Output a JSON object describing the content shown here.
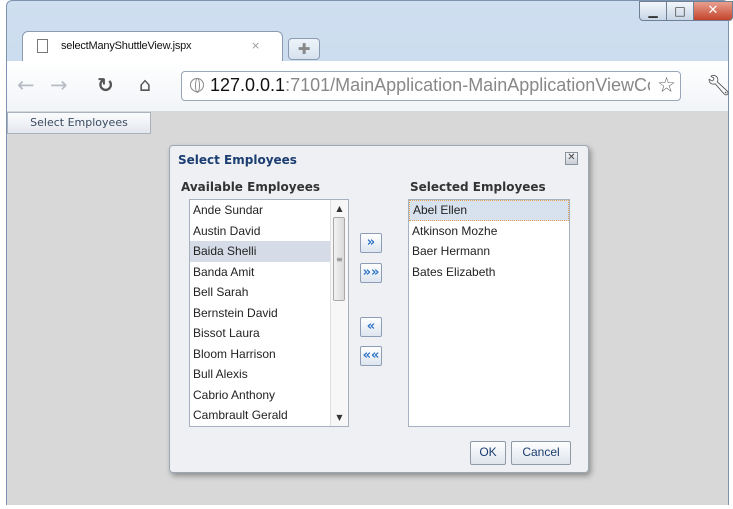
{
  "browser": {
    "tab_title": "selectManyShuttleView.jspx",
    "tab_close": "×",
    "new_tab": "✚",
    "url_host": "127.0.0.1",
    "url_rest": ":7101/MainApplication-MainApplicationViewCor",
    "window_controls": {
      "minimize": "▁",
      "maximize": "□",
      "close": "✕"
    }
  },
  "page": {
    "open_dialog_button": "Select Employees"
  },
  "dialog": {
    "title": "Select Employees",
    "close": "✕",
    "available_heading": "Available Employees",
    "selected_heading": "Selected Employees",
    "available": [
      "Ande Sundar",
      "Austin David",
      "Baida Shelli",
      "Banda Amit",
      "Bell Sarah",
      "Bernstein David",
      "Bissot Laura",
      "Bloom Harrison",
      "Bull Alexis",
      "Cabrio Anthony",
      "Cambrault Gerald"
    ],
    "available_selected_index": 2,
    "selected": [
      "Abel Ellen",
      "Atkinson Mozhe",
      "Baer Hermann",
      "Bates Elizabeth"
    ],
    "selected_focused_index": 0,
    "move_right": "»",
    "move_all_right": "»»",
    "move_left": "«",
    "move_all_left": "««",
    "ok": "OK",
    "cancel": "Cancel"
  }
}
